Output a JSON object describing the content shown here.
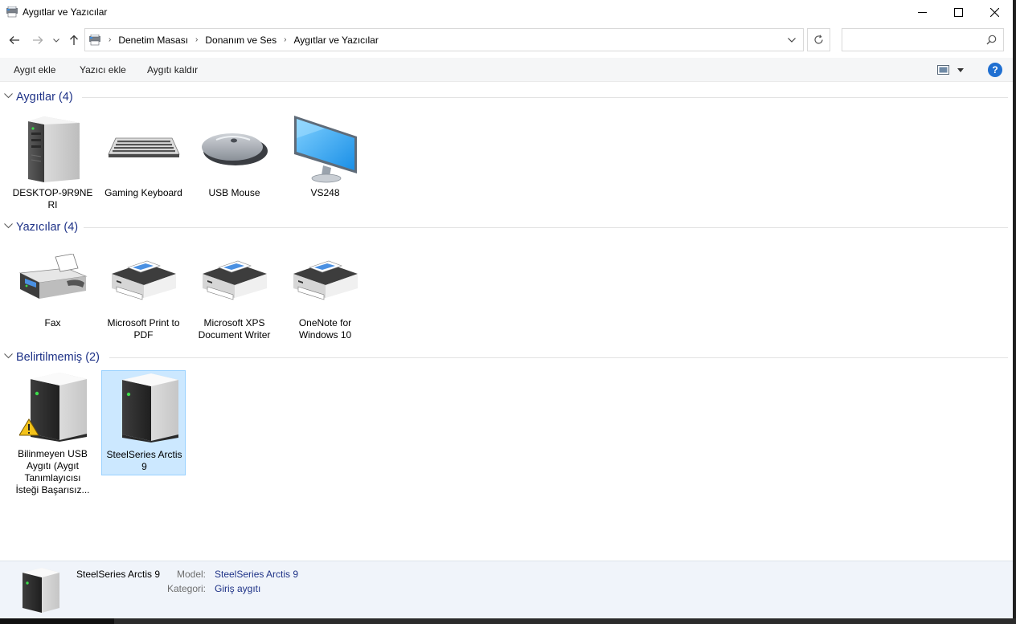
{
  "window": {
    "title": "Aygıtlar ve Yazıcılar",
    "controls": {
      "minimize": "minimize",
      "maximize": "maximize",
      "close": "close"
    }
  },
  "address": {
    "crumbs": [
      "Denetim Masası",
      "Donanım ve Ses",
      "Aygıtlar ve Yazıcılar"
    ],
    "search_placeholder": ""
  },
  "toolbar": {
    "add_device": "Aygıt ekle",
    "add_printer": "Yazıcı ekle",
    "remove_device": "Aygıtı kaldır"
  },
  "groups": {
    "devices": {
      "label": "Aygıtlar (4)",
      "items": [
        {
          "label": "DESKTOP-9R9NE RI",
          "icon": "computer-tower-icon"
        },
        {
          "label": "Gaming Keyboard",
          "icon": "keyboard-icon"
        },
        {
          "label": "USB Mouse",
          "icon": "mouse-icon"
        },
        {
          "label": "VS248",
          "icon": "monitor-icon"
        }
      ]
    },
    "printers": {
      "label": "Yazıcılar (4)",
      "items": [
        {
          "label": "Fax",
          "icon": "fax-icon"
        },
        {
          "label": "Microsoft Print to PDF",
          "icon": "printer-icon"
        },
        {
          "label": "Microsoft XPS Document Writer",
          "icon": "printer-icon"
        },
        {
          "label": "OneNote for Windows 10",
          "icon": "printer-icon"
        }
      ]
    },
    "unspecified": {
      "label": "Belirtilmemiş (2)",
      "items": [
        {
          "label": "Bilinmeyen USB Aygıtı (Aygıt Tanımlayıcısı İsteği Başarısız...",
          "icon": "generic-device-warning-icon"
        },
        {
          "label": "SteelSeries Arctis 9",
          "icon": "generic-device-icon",
          "selected": true
        }
      ]
    }
  },
  "details": {
    "name": "SteelSeries Arctis 9",
    "model_key": "Model:",
    "model_value": "SteelSeries Arctis 9",
    "category_key": "Kategori:",
    "category_value": "Giriş aygıtı"
  },
  "colors": {
    "group_header": "#1e3287",
    "selection_bg": "#cce8ff",
    "selection_border": "#99d1ff",
    "details_bg": "#f0f4fa",
    "help": "#1f6fd1"
  }
}
